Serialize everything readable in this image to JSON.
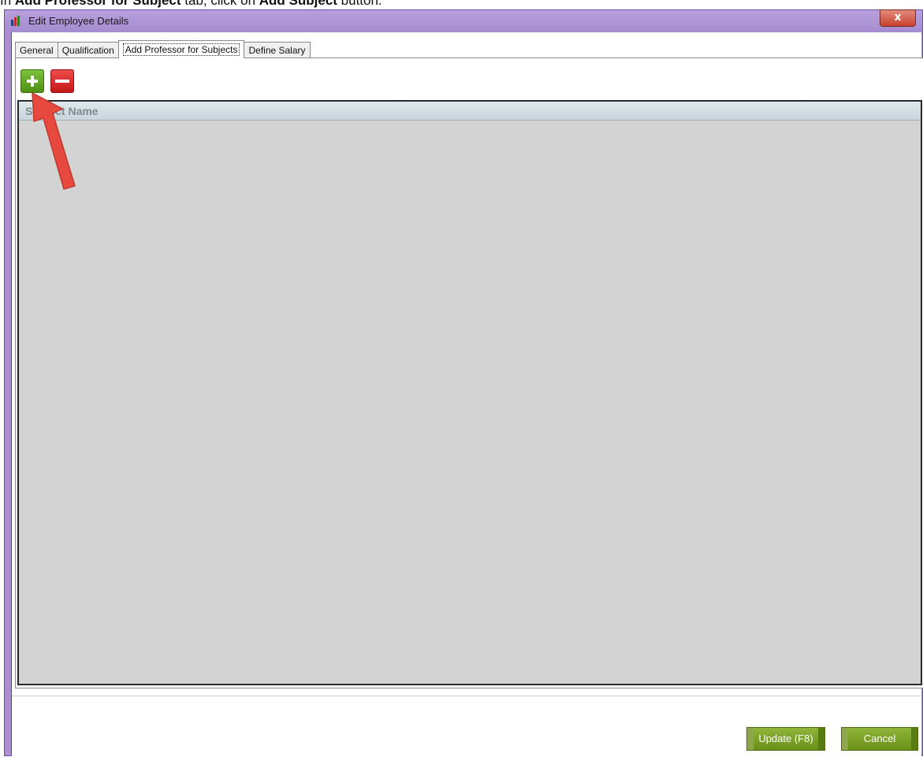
{
  "instruction": {
    "prefix": "In ",
    "tab_name": "Add Professor for Subject",
    "middle": " tab, click on ",
    "button_name": "Add Subject",
    "suffix": " button."
  },
  "window": {
    "title": "Edit Employee Details",
    "close_glyph": "x"
  },
  "tabs": [
    {
      "label": "General",
      "active": false
    },
    {
      "label": "Qualification",
      "active": false
    },
    {
      "label": "Add Professor for Subjects",
      "active": true
    },
    {
      "label": "Define Salary",
      "active": false
    }
  ],
  "grid": {
    "columns": [
      "Subject Name"
    ],
    "rows": []
  },
  "footer": {
    "update_label": "Update (F8)",
    "cancel_label": "Cancel"
  },
  "colors": {
    "titlebar": "#a98fd2",
    "add_button": "#5fa61f",
    "remove_button": "#d82424",
    "action_button": "#7a9f24",
    "annotation_arrow": "#e8493e"
  },
  "icons": {
    "app": "app-logo-icon",
    "add": "plus-icon",
    "remove": "minus-icon"
  }
}
